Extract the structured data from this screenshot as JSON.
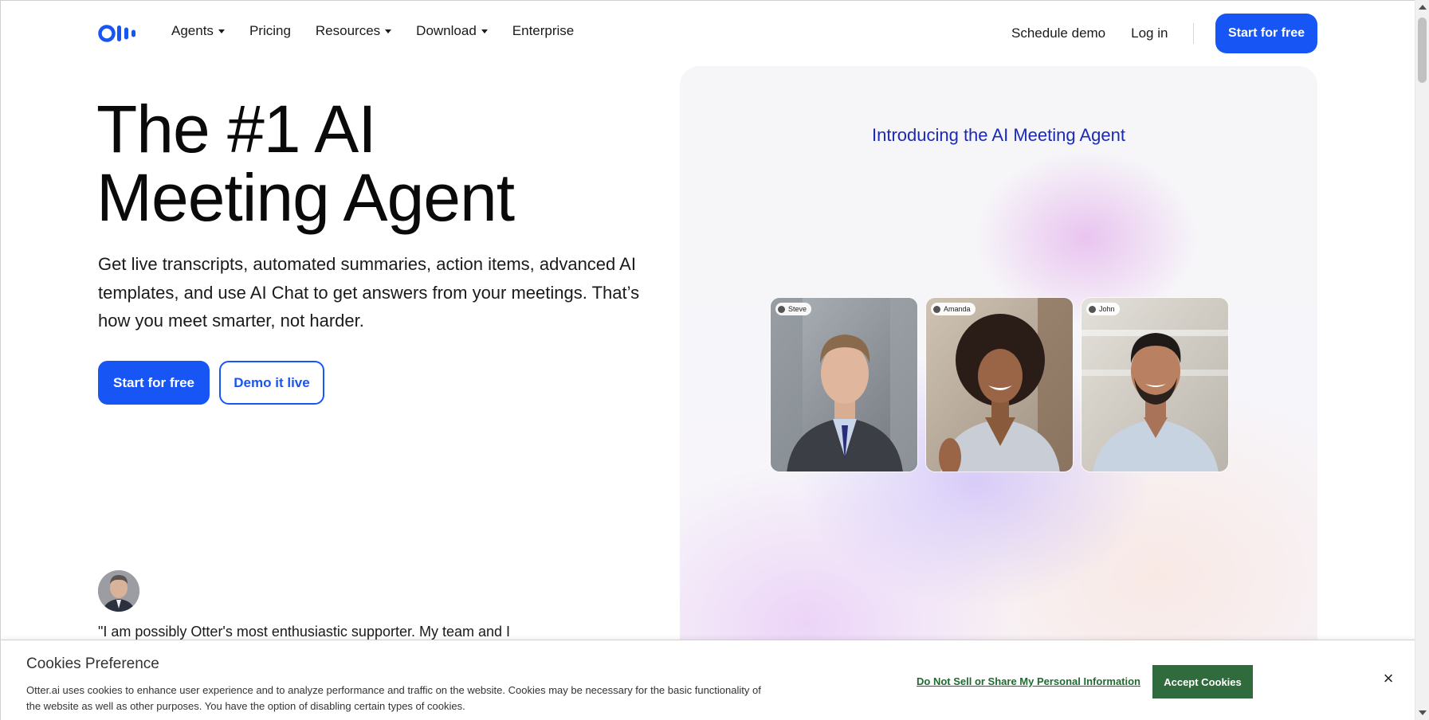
{
  "nav": {
    "items": [
      {
        "label": "Agents",
        "dropdown": true
      },
      {
        "label": "Pricing",
        "dropdown": false
      },
      {
        "label": "Resources",
        "dropdown": true
      },
      {
        "label": "Download",
        "dropdown": true
      },
      {
        "label": "Enterprise",
        "dropdown": false
      }
    ],
    "schedule_demo": "Schedule demo",
    "log_in": "Log in",
    "start_free": "Start for free"
  },
  "hero": {
    "title_line1": "The #1 AI",
    "title_line2": "Meeting Agent",
    "subtitle": "Get live transcripts, automated summaries, action items, advanced AI templates, and use AI Chat to get answers from your meetings. That’s how you meet smarter, not harder.",
    "primary_cta": "Start for free",
    "secondary_cta": "Demo it live",
    "quote": "\"I am possibly Otter's most enthusiastic supporter. My team and I"
  },
  "card": {
    "heading": "Introducing the AI Meeting Agent",
    "participants": [
      "Steve",
      "Amanda",
      "John"
    ]
  },
  "cookie": {
    "title": "Cookies Preference",
    "text": "Otter.ai uses cookies to enhance user experience and to analyze performance and traffic on the website. Cookies may be necessary for the basic functionality of the website as well as other purposes. You have the option of disabling certain types of cookies.",
    "do_not_sell": "Do Not Sell or Share My Personal Information",
    "accept": "Accept Cookies",
    "close": "×"
  },
  "colors": {
    "brand_blue": "#1755f4",
    "heading_blue": "#1c2ab3",
    "cookie_green": "#2f6b3c"
  }
}
